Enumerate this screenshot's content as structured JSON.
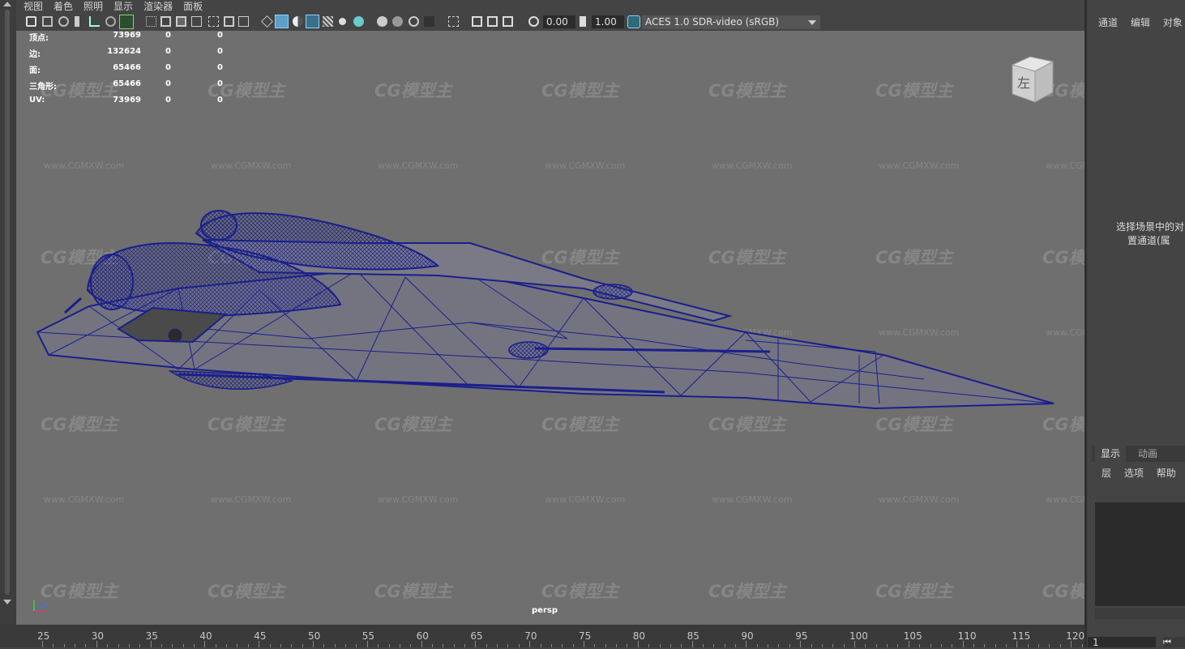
{
  "menu": {
    "items": [
      "视图",
      "着色",
      "照明",
      "显示",
      "渲染器",
      "面板"
    ]
  },
  "toolbar": {
    "exposure_value": "0.00",
    "gamma_value": "1.00",
    "color_space": "ACES 1.0 SDR-video (sRGB)"
  },
  "hud": {
    "rows": [
      {
        "label": "顶点:",
        "v1": "73969",
        "v2": "0",
        "v3": "0"
      },
      {
        "label": "边:",
        "v1": "132624",
        "v2": "0",
        "v3": "0"
      },
      {
        "label": "面:",
        "v1": "65466",
        "v2": "0",
        "v3": "0"
      },
      {
        "label": "三角形:",
        "v1": "65466",
        "v2": "0",
        "v3": "0"
      },
      {
        "label": "UV:",
        "v1": "73969",
        "v2": "0",
        "v3": "0"
      }
    ]
  },
  "viewcube": {
    "face_label": "左"
  },
  "camera_label": "persp",
  "watermark": {
    "logo": "CG模型主",
    "url": "www.CGMXW.com"
  },
  "timeline": {
    "ticks": [
      "25",
      "30",
      "35",
      "40",
      "45",
      "50",
      "55",
      "60",
      "65",
      "70",
      "75",
      "80",
      "85",
      "90",
      "95",
      "100",
      "105",
      "110",
      "115",
      "120"
    ]
  },
  "right_panel": {
    "channel_tabs": [
      "通道",
      "编辑",
      "对象"
    ],
    "hint_line1": "选择场景中的对",
    "hint_line2": "置通道(属",
    "layer_tabs": [
      "显示",
      "动画"
    ],
    "layer_menu": [
      "层",
      "选项",
      "帮助"
    ],
    "frame_value": "1",
    "frame_button": "⏮"
  },
  "colors": {
    "wireframe": "#1a1f8c",
    "viewport_bg": "#6f6f6f",
    "ui_bg": "#444444"
  }
}
